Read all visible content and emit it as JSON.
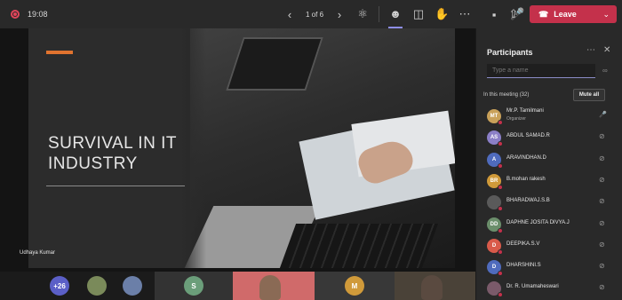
{
  "topbar": {
    "time": "19:08",
    "pager": "1 of 6",
    "leave_label": "Leave"
  },
  "slide": {
    "title_line1": "SURVIVAL IN IT",
    "title_line2": "INDUSTRY",
    "presenter": "Udhaya Kumar"
  },
  "strip": {
    "overflow_count": "+26",
    "tile_s": "S",
    "tile_m": "M"
  },
  "panel": {
    "title": "Participants",
    "search_placeholder": "Type a name",
    "section_label": "In this meeting (32)",
    "mute_all_label": "Mute all",
    "participants": [
      {
        "initials": "MT",
        "name": "Mr.P. Tamilmani",
        "role": "Organizer",
        "color": "#c9a15a"
      },
      {
        "initials": "AS",
        "name": "ABDUL SAMAD.R",
        "color": "#8b7fc7"
      },
      {
        "initials": "A",
        "name": "ARAVINDHAN.D",
        "color": "#4f6bbd"
      },
      {
        "initials": "BR",
        "name": "B.mohan rakesh",
        "color": "#d09a3a"
      },
      {
        "initials": "",
        "name": "BHARADWAJ.S.B",
        "color": "#5a5a5a"
      },
      {
        "initials": "DD",
        "name": "DAPHNE JOSITA DIVYA.J",
        "color": "#6b8e6b"
      },
      {
        "initials": "D",
        "name": "DEEPIKA.S.V",
        "color": "#d95a4a"
      },
      {
        "initials": "D",
        "name": "DHARSHINI.S",
        "color": "#4f6bbd"
      },
      {
        "initials": "",
        "name": "Dr. R. Umamaheswari",
        "color": "#7a5a6a"
      }
    ]
  },
  "colors": {
    "leave_red": "#c4314b",
    "accent_orange": "#e0732f",
    "purple_accent": "#8e8ee6"
  }
}
